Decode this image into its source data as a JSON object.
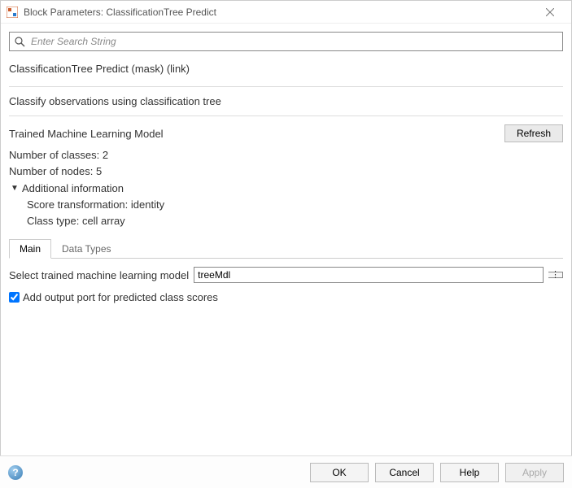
{
  "window": {
    "title": "Block Parameters: ClassificationTree Predict"
  },
  "search": {
    "placeholder": "Enter Search String"
  },
  "block": {
    "heading": "ClassificationTree Predict (mask) (link)",
    "description": "Classify observations using classification tree"
  },
  "model_section": {
    "label": "Trained Machine Learning Model",
    "refresh": "Refresh",
    "num_classes_label": "Number of classes:",
    "num_classes_value": "2",
    "num_nodes_label": "Number of nodes:",
    "num_nodes_value": "5",
    "additional_info": "Additional information",
    "score_transformation_label": "Score transformation:",
    "score_transformation_value": "identity",
    "class_type_label": "Class type:",
    "class_type_value": "cell array"
  },
  "tabs": {
    "main": "Main",
    "data_types": "Data Types"
  },
  "main_tab": {
    "select_model_label": "Select trained machine learning model",
    "select_model_value": "treeMdl",
    "checkbox_label": "Add output port for predicted class scores",
    "checkbox_checked": true
  },
  "footer": {
    "ok": "OK",
    "cancel": "Cancel",
    "help": "Help",
    "apply": "Apply"
  }
}
